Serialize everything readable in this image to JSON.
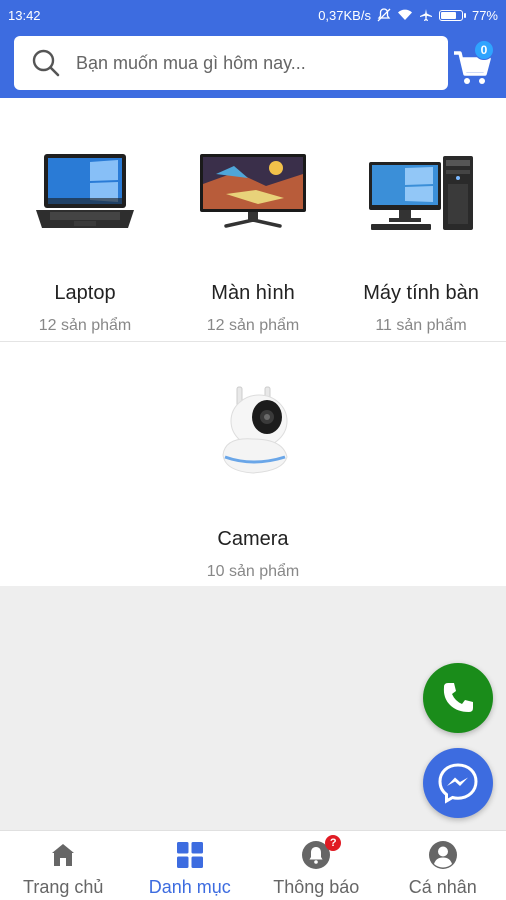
{
  "status_bar": {
    "time": "13:42",
    "speed": "0,37KB/s",
    "battery": "77%",
    "battery_level": 0.77
  },
  "header": {
    "search_placeholder": "Bạn muốn mua gì hôm nay...",
    "cart_count": "0"
  },
  "categories": [
    {
      "name": "Laptop",
      "count": "12 sản phẩm",
      "image": "laptop-image"
    },
    {
      "name": "Màn hình",
      "count": "12 sản phẩm",
      "image": "monitor-image"
    },
    {
      "name": "Máy tính bàn",
      "count": "11 sản phẩm",
      "image": "desktop-pc-image"
    },
    {
      "name": "Camera",
      "count": "10 sản phẩm",
      "image": "security-camera-image"
    }
  ],
  "fabs": {
    "phone": "phone-icon",
    "messenger": "messenger-icon"
  },
  "bottom_nav": [
    {
      "label": "Trang chủ",
      "icon": "home-icon",
      "active": false
    },
    {
      "label": "Danh mục",
      "icon": "grid-icon",
      "active": true
    },
    {
      "label": "Thông báo",
      "icon": "bell-icon",
      "active": false,
      "badge": "?"
    },
    {
      "label": "Cá nhân",
      "icon": "user-icon",
      "active": false
    }
  ],
  "colors": {
    "primary": "#3d6ce0",
    "phone_green": "#1a8c1a",
    "badge_red": "#e01b24"
  }
}
